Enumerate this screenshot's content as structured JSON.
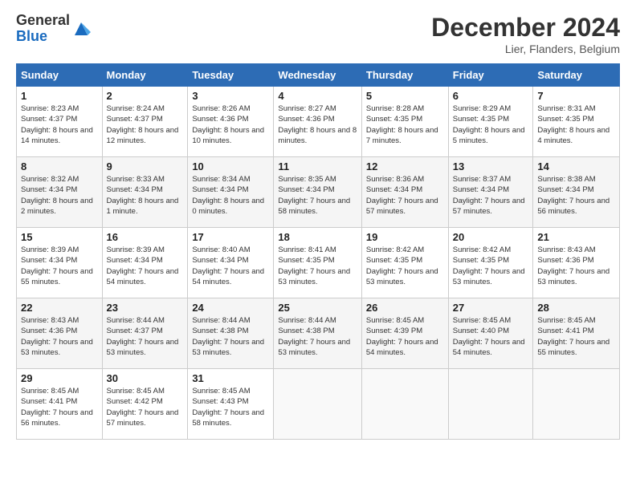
{
  "logo": {
    "line1": "General",
    "line2": "Blue"
  },
  "title": "December 2024",
  "subtitle": "Lier, Flanders, Belgium",
  "days_header": [
    "Sunday",
    "Monday",
    "Tuesday",
    "Wednesday",
    "Thursday",
    "Friday",
    "Saturday"
  ],
  "weeks": [
    [
      {
        "day": "1",
        "sunrise": "Sunrise: 8:23 AM",
        "sunset": "Sunset: 4:37 PM",
        "daylight": "Daylight: 8 hours and 14 minutes."
      },
      {
        "day": "2",
        "sunrise": "Sunrise: 8:24 AM",
        "sunset": "Sunset: 4:37 PM",
        "daylight": "Daylight: 8 hours and 12 minutes."
      },
      {
        "day": "3",
        "sunrise": "Sunrise: 8:26 AM",
        "sunset": "Sunset: 4:36 PM",
        "daylight": "Daylight: 8 hours and 10 minutes."
      },
      {
        "day": "4",
        "sunrise": "Sunrise: 8:27 AM",
        "sunset": "Sunset: 4:36 PM",
        "daylight": "Daylight: 8 hours and 8 minutes."
      },
      {
        "day": "5",
        "sunrise": "Sunrise: 8:28 AM",
        "sunset": "Sunset: 4:35 PM",
        "daylight": "Daylight: 8 hours and 7 minutes."
      },
      {
        "day": "6",
        "sunrise": "Sunrise: 8:29 AM",
        "sunset": "Sunset: 4:35 PM",
        "daylight": "Daylight: 8 hours and 5 minutes."
      },
      {
        "day": "7",
        "sunrise": "Sunrise: 8:31 AM",
        "sunset": "Sunset: 4:35 PM",
        "daylight": "Daylight: 8 hours and 4 minutes."
      }
    ],
    [
      {
        "day": "8",
        "sunrise": "Sunrise: 8:32 AM",
        "sunset": "Sunset: 4:34 PM",
        "daylight": "Daylight: 8 hours and 2 minutes."
      },
      {
        "day": "9",
        "sunrise": "Sunrise: 8:33 AM",
        "sunset": "Sunset: 4:34 PM",
        "daylight": "Daylight: 8 hours and 1 minute."
      },
      {
        "day": "10",
        "sunrise": "Sunrise: 8:34 AM",
        "sunset": "Sunset: 4:34 PM",
        "daylight": "Daylight: 8 hours and 0 minutes."
      },
      {
        "day": "11",
        "sunrise": "Sunrise: 8:35 AM",
        "sunset": "Sunset: 4:34 PM",
        "daylight": "Daylight: 7 hours and 58 minutes."
      },
      {
        "day": "12",
        "sunrise": "Sunrise: 8:36 AM",
        "sunset": "Sunset: 4:34 PM",
        "daylight": "Daylight: 7 hours and 57 minutes."
      },
      {
        "day": "13",
        "sunrise": "Sunrise: 8:37 AM",
        "sunset": "Sunset: 4:34 PM",
        "daylight": "Daylight: 7 hours and 57 minutes."
      },
      {
        "day": "14",
        "sunrise": "Sunrise: 8:38 AM",
        "sunset": "Sunset: 4:34 PM",
        "daylight": "Daylight: 7 hours and 56 minutes."
      }
    ],
    [
      {
        "day": "15",
        "sunrise": "Sunrise: 8:39 AM",
        "sunset": "Sunset: 4:34 PM",
        "daylight": "Daylight: 7 hours and 55 minutes."
      },
      {
        "day": "16",
        "sunrise": "Sunrise: 8:39 AM",
        "sunset": "Sunset: 4:34 PM",
        "daylight": "Daylight: 7 hours and 54 minutes."
      },
      {
        "day": "17",
        "sunrise": "Sunrise: 8:40 AM",
        "sunset": "Sunset: 4:34 PM",
        "daylight": "Daylight: 7 hours and 54 minutes."
      },
      {
        "day": "18",
        "sunrise": "Sunrise: 8:41 AM",
        "sunset": "Sunset: 4:35 PM",
        "daylight": "Daylight: 7 hours and 53 minutes."
      },
      {
        "day": "19",
        "sunrise": "Sunrise: 8:42 AM",
        "sunset": "Sunset: 4:35 PM",
        "daylight": "Daylight: 7 hours and 53 minutes."
      },
      {
        "day": "20",
        "sunrise": "Sunrise: 8:42 AM",
        "sunset": "Sunset: 4:35 PM",
        "daylight": "Daylight: 7 hours and 53 minutes."
      },
      {
        "day": "21",
        "sunrise": "Sunrise: 8:43 AM",
        "sunset": "Sunset: 4:36 PM",
        "daylight": "Daylight: 7 hours and 53 minutes."
      }
    ],
    [
      {
        "day": "22",
        "sunrise": "Sunrise: 8:43 AM",
        "sunset": "Sunset: 4:36 PM",
        "daylight": "Daylight: 7 hours and 53 minutes."
      },
      {
        "day": "23",
        "sunrise": "Sunrise: 8:44 AM",
        "sunset": "Sunset: 4:37 PM",
        "daylight": "Daylight: 7 hours and 53 minutes."
      },
      {
        "day": "24",
        "sunrise": "Sunrise: 8:44 AM",
        "sunset": "Sunset: 4:38 PM",
        "daylight": "Daylight: 7 hours and 53 minutes."
      },
      {
        "day": "25",
        "sunrise": "Sunrise: 8:44 AM",
        "sunset": "Sunset: 4:38 PM",
        "daylight": "Daylight: 7 hours and 53 minutes."
      },
      {
        "day": "26",
        "sunrise": "Sunrise: 8:45 AM",
        "sunset": "Sunset: 4:39 PM",
        "daylight": "Daylight: 7 hours and 54 minutes."
      },
      {
        "day": "27",
        "sunrise": "Sunrise: 8:45 AM",
        "sunset": "Sunset: 4:40 PM",
        "daylight": "Daylight: 7 hours and 54 minutes."
      },
      {
        "day": "28",
        "sunrise": "Sunrise: 8:45 AM",
        "sunset": "Sunset: 4:41 PM",
        "daylight": "Daylight: 7 hours and 55 minutes."
      }
    ],
    [
      {
        "day": "29",
        "sunrise": "Sunrise: 8:45 AM",
        "sunset": "Sunset: 4:41 PM",
        "daylight": "Daylight: 7 hours and 56 minutes."
      },
      {
        "day": "30",
        "sunrise": "Sunrise: 8:45 AM",
        "sunset": "Sunset: 4:42 PM",
        "daylight": "Daylight: 7 hours and 57 minutes."
      },
      {
        "day": "31",
        "sunrise": "Sunrise: 8:45 AM",
        "sunset": "Sunset: 4:43 PM",
        "daylight": "Daylight: 7 hours and 58 minutes."
      },
      null,
      null,
      null,
      null
    ]
  ]
}
